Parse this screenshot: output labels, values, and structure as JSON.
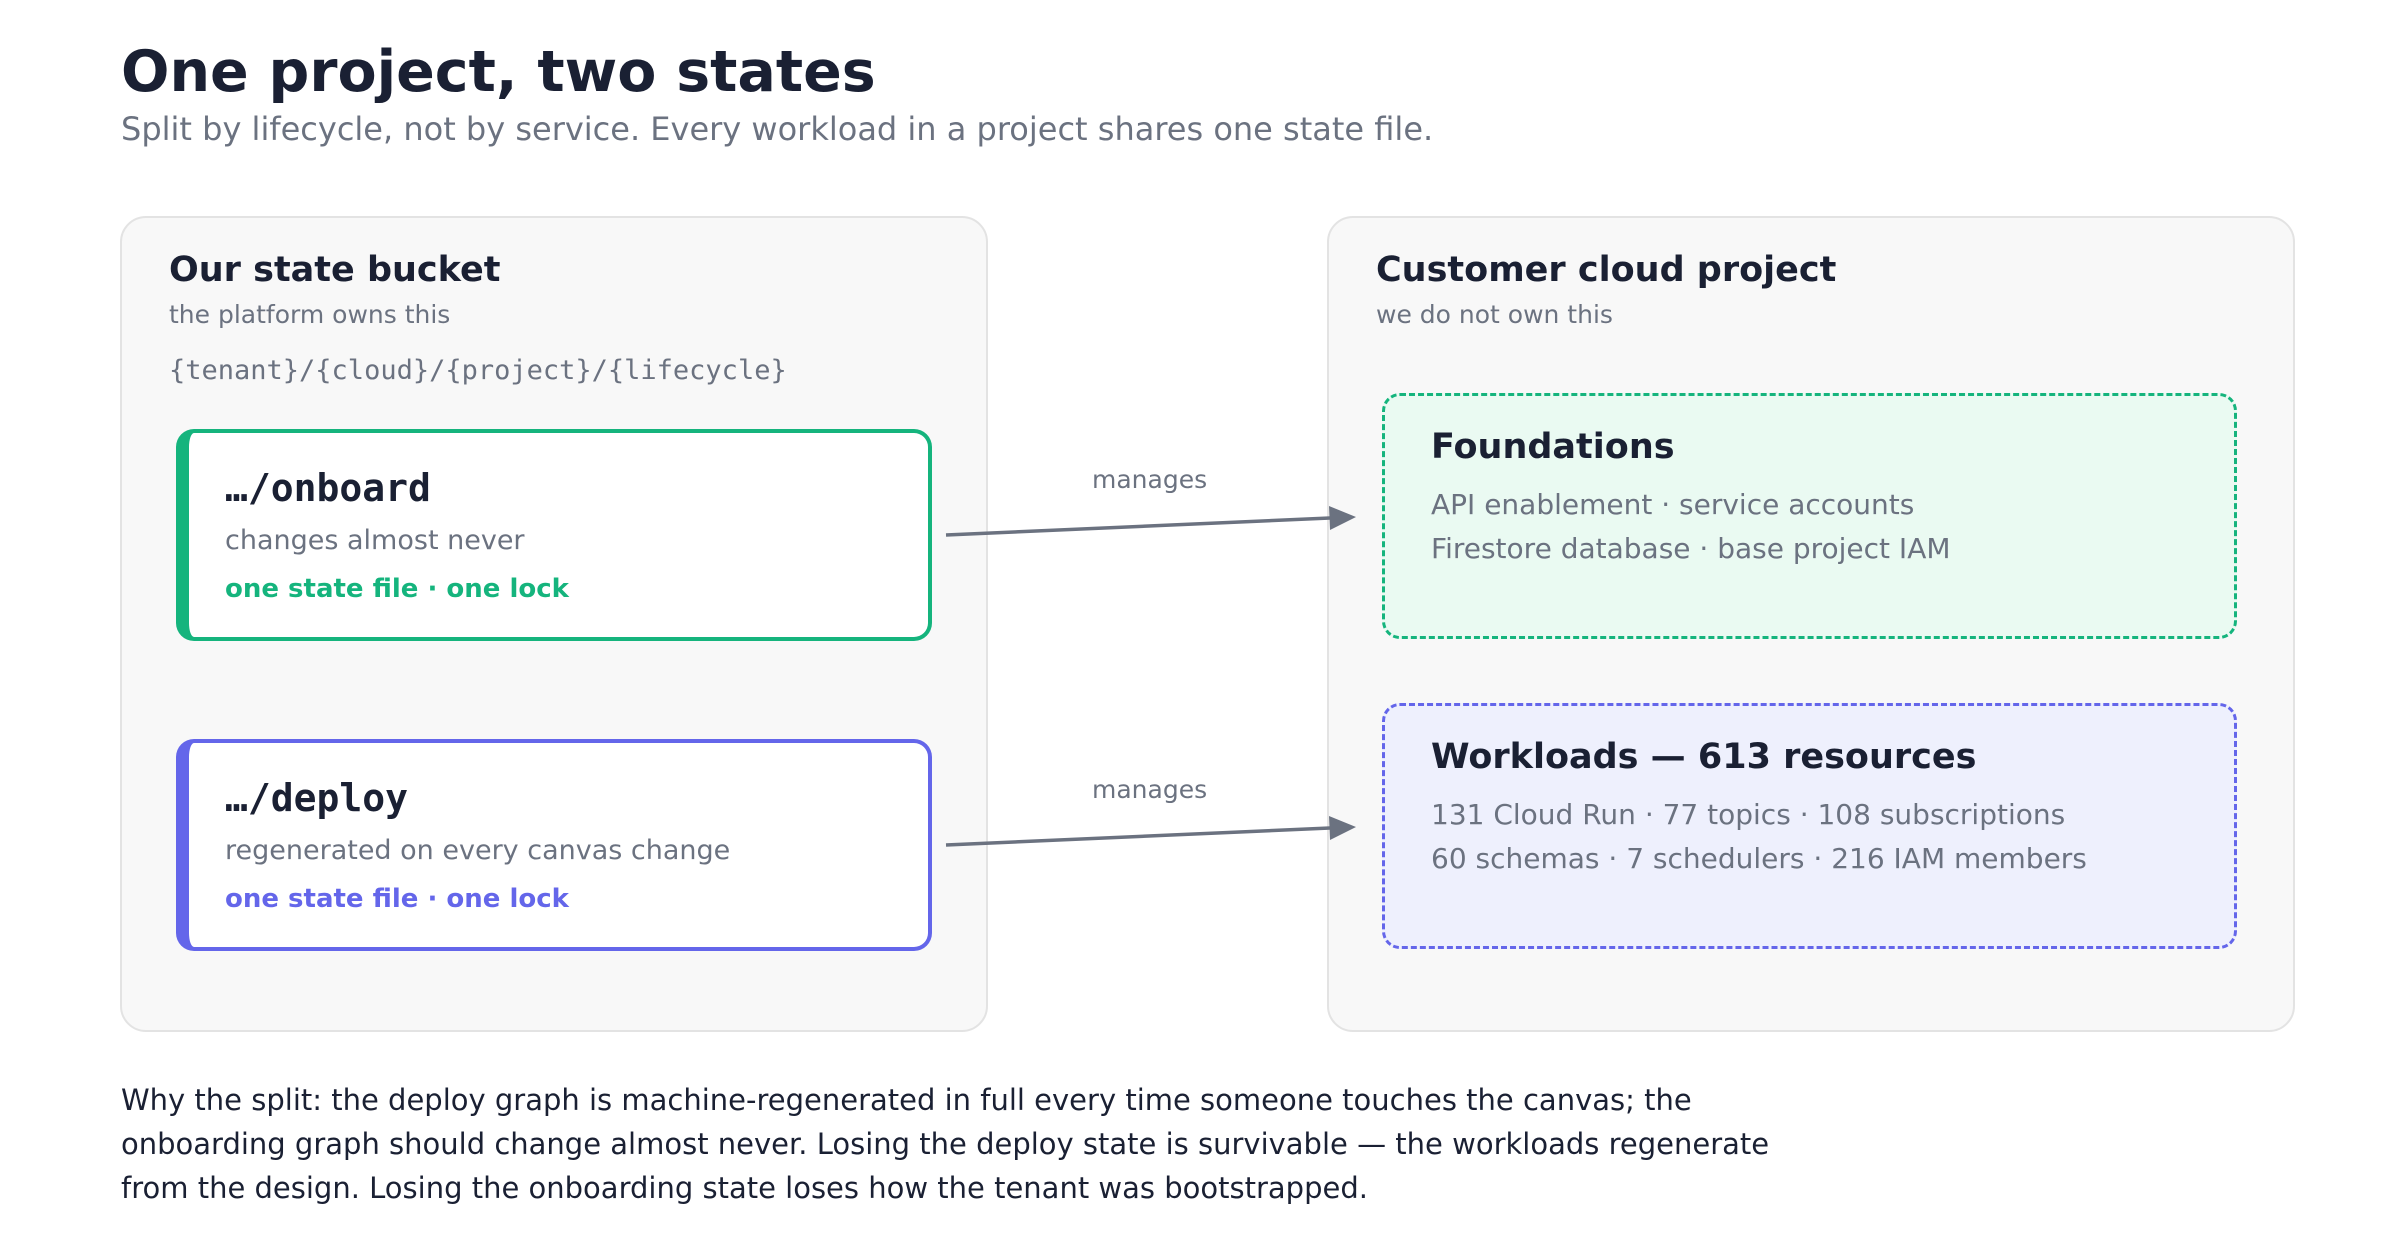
{
  "header": {
    "title": "One project, two states",
    "subtitle": "Split by lifecycle, not by service. Every workload in a project shares one state file."
  },
  "state_bucket": {
    "title": "Our state bucket",
    "subtitle": "the platform owns this",
    "path_pattern": "{tenant}/{cloud}/{project}/{lifecycle}",
    "states": [
      {
        "name": "…/onboard",
        "description": "changes almost never",
        "lock": "one state file · one lock",
        "color": "#15b47d"
      },
      {
        "name": "…/deploy",
        "description": "regenerated on every canvas change",
        "lock": "one state file · one lock",
        "color": "#6466ea"
      }
    ]
  },
  "customer_project": {
    "title": "Customer cloud project",
    "subtitle": "we do not own this",
    "groups": [
      {
        "title": "Foundations",
        "lines": [
          "API enablement · service accounts",
          "Firestore database · base project IAM"
        ],
        "border_color": "#15b47d",
        "fill_color": "#eafaf2"
      },
      {
        "title": "Workloads — 613 resources",
        "lines": [
          "131 Cloud Run · 77 topics · 108 subscriptions",
          "60 schemas · 7 schedulers · 216 IAM members"
        ],
        "border_color": "#6466ea",
        "fill_color": "#eef0fd"
      }
    ]
  },
  "edges": [
    {
      "from": "…/onboard",
      "to": "Foundations",
      "label": "manages"
    },
    {
      "from": "…/deploy",
      "to": "Workloads — 613 resources",
      "label": "manages"
    }
  ],
  "footer": {
    "lines": [
      "Why the split: the deploy graph is machine-regenerated in full every time someone touches the canvas; the",
      "onboarding graph should change almost never. Losing the deploy state is survivable — the workloads regenerate",
      "from the design. Losing the onboarding state loses how the tenant was bootstrapped."
    ]
  },
  "colors": {
    "text_primary": "#1a2033",
    "text_muted": "#6b7280",
    "arrow": "#6b7280",
    "panel_fill": "#f8f8f8",
    "panel_border": "#e3e3e3"
  }
}
